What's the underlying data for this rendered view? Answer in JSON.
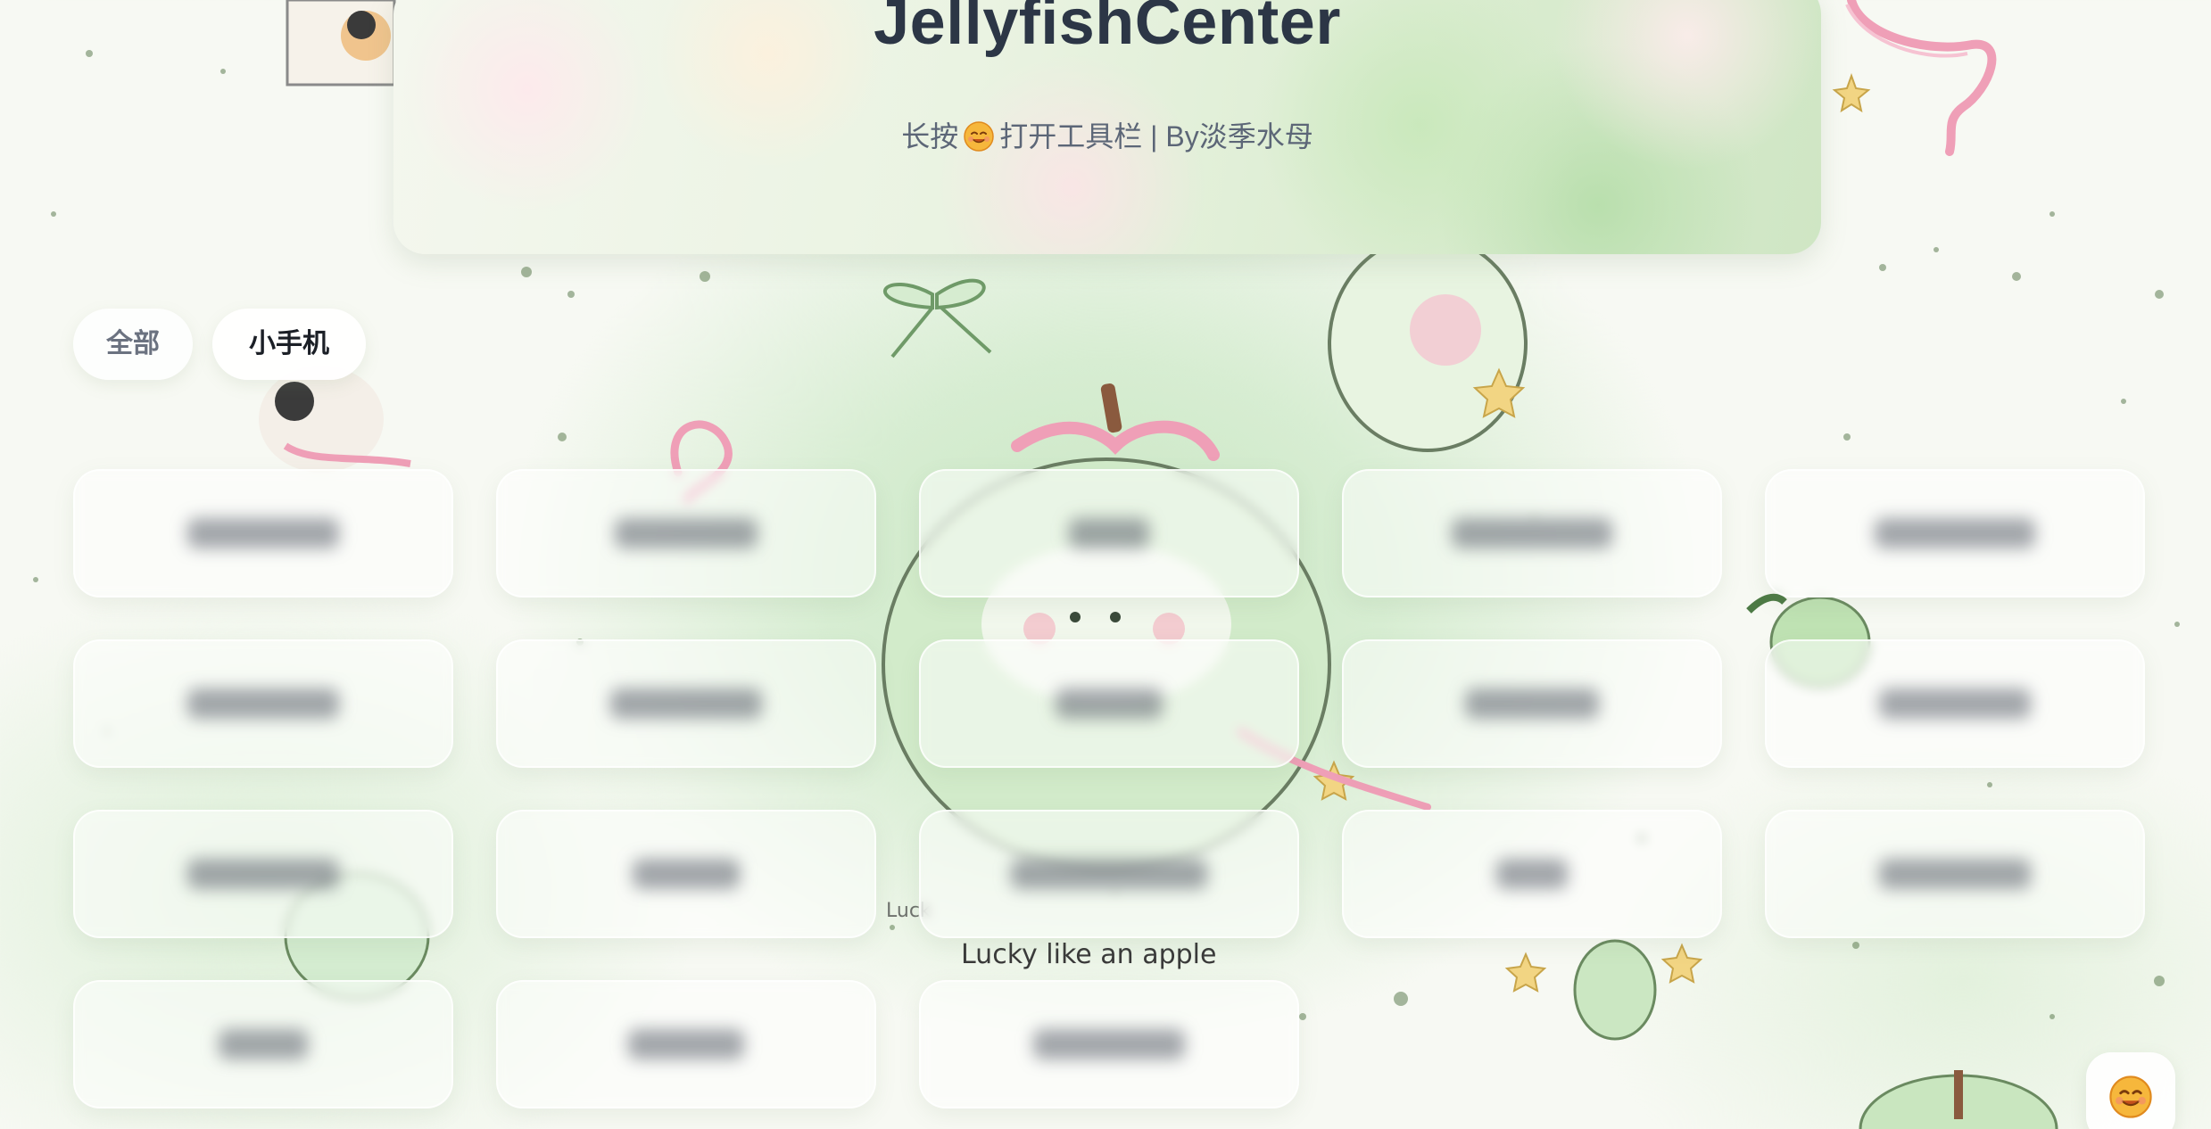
{
  "header": {
    "title": "JellyfishCenter",
    "subtitle_before": "长按",
    "subtitle_after": "打开工具栏 | By淡季水母"
  },
  "tabs": [
    {
      "label": "全部",
      "active": false
    },
    {
      "label": "小手机",
      "active": true
    }
  ],
  "background_text": "Lucky like an apple",
  "card_count": 18,
  "colors": {
    "title": "#2c3646",
    "subtitle": "#5c6677",
    "accent_green": "#cfe6c4",
    "ribbon_pink": "#f2a7bd"
  },
  "icons": {
    "toolbar": "smiling-face-icon",
    "floating": "smiling-face-icon"
  }
}
